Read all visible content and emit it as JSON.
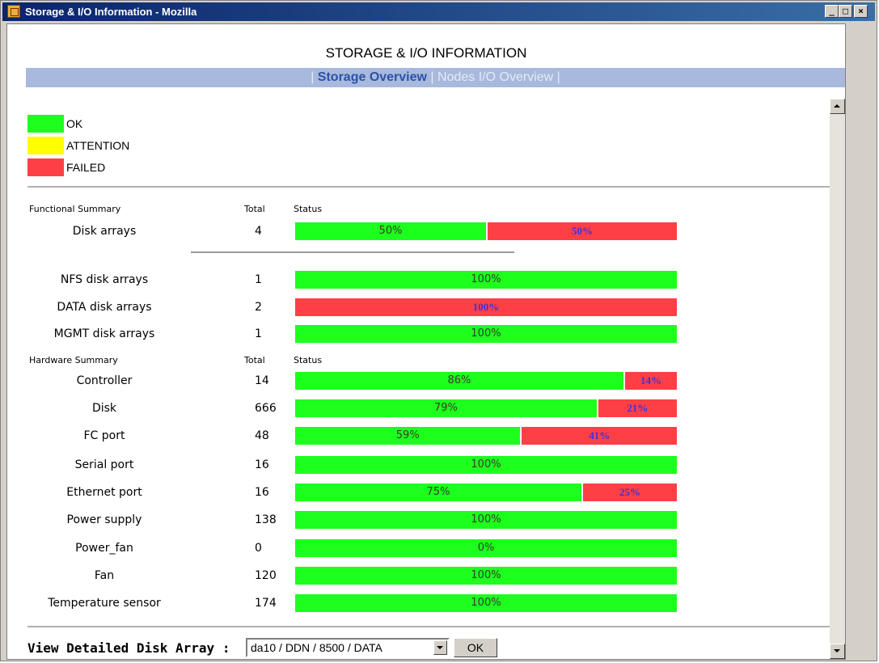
{
  "window": {
    "title": "Storage & I/O Information - Mozilla"
  },
  "page": {
    "title": "STORAGE & I/O INFORMATION",
    "nav": {
      "active": "Storage Overview",
      "inactive": "Nodes I/O Overview",
      "sep": "|"
    }
  },
  "legend": [
    {
      "label": "OK",
      "color": "#1dff1d"
    },
    {
      "label": "ATTENTION",
      "color": "#ffff00"
    },
    {
      "label": "FAILED",
      "color": "#ff3f46"
    }
  ],
  "functional": {
    "header": "Functional Summary",
    "total_header": "Total",
    "status_header": "Status",
    "rows": [
      {
        "name": "Disk arrays",
        "total": "4",
        "ok": 50,
        "fail": 50,
        "ok_label": "50%",
        "fail_label": "50%"
      }
    ],
    "sub_rows": [
      {
        "name": "NFS disk arrays",
        "total": "1",
        "ok": 100,
        "fail": 0,
        "ok_label": "100%",
        "fail_label": ""
      },
      {
        "name": "DATA disk arrays",
        "total": "2",
        "ok": 0,
        "fail": 100,
        "ok_label": "",
        "fail_label": "100%"
      },
      {
        "name": "MGMT disk arrays",
        "total": "1",
        "ok": 100,
        "fail": 0,
        "ok_label": "100%",
        "fail_label": ""
      }
    ]
  },
  "hardware": {
    "header": "Hardware Summary",
    "total_header": "Total",
    "status_header": "Status",
    "rows": [
      {
        "name": "Controller",
        "total": "14",
        "ok": 86,
        "fail": 14,
        "ok_label": "86%",
        "fail_label": "14%"
      },
      {
        "name": "Disk",
        "total": "666",
        "ok": 79,
        "fail": 21,
        "ok_label": "79%",
        "fail_label": "21%"
      },
      {
        "name": "FC port",
        "total": "48",
        "ok": 59,
        "fail": 41,
        "ok_label": "59%",
        "fail_label": "41%"
      },
      {
        "name": "Serial port",
        "total": "16",
        "ok": 100,
        "fail": 0,
        "ok_label": "100%",
        "fail_label": ""
      },
      {
        "name": "Ethernet port",
        "total": "16",
        "ok": 75,
        "fail": 25,
        "ok_label": "75%",
        "fail_label": "25%"
      },
      {
        "name": "Power supply",
        "total": "138",
        "ok": 100,
        "fail": 0,
        "ok_label": "100%",
        "fail_label": ""
      },
      {
        "name": "Power_fan",
        "total": "0",
        "ok": 100,
        "fail": 0,
        "ok_label": "0%",
        "fail_label": ""
      },
      {
        "name": "Fan",
        "total": "120",
        "ok": 100,
        "fail": 0,
        "ok_label": "100%",
        "fail_label": ""
      },
      {
        "name": "Temperature sensor",
        "total": "174",
        "ok": 100,
        "fail": 0,
        "ok_label": "100%",
        "fail_label": ""
      }
    ]
  },
  "footer": {
    "label": "View Detailed Disk Array :",
    "selected": "da10 / DDN / 8500 / DATA",
    "ok_button": "OK"
  },
  "window_buttons": {
    "minimize": "_",
    "maximize": "□",
    "close": "×"
  }
}
